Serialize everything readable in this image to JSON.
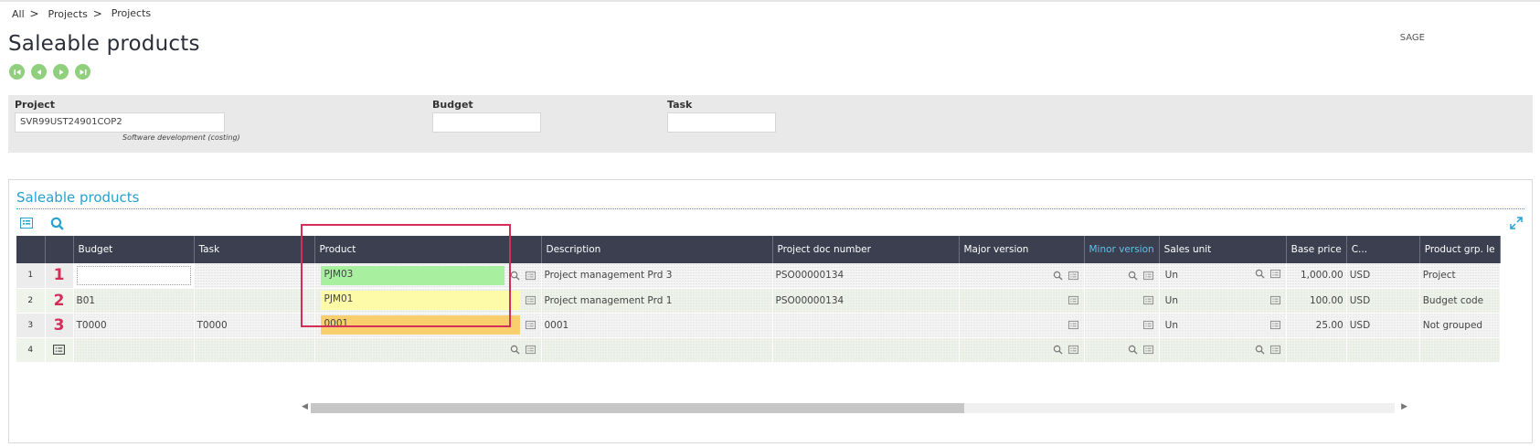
{
  "breadcrumb": [
    "All",
    "Projects",
    "Projects"
  ],
  "page_title": "Saleable products",
  "folder": "SAGE",
  "criteria": {
    "project_label": "Project",
    "project_value": "SVR99UST24901COP2",
    "project_help": "Software development (costing)",
    "budget_label": "Budget",
    "budget_value": "",
    "task_label": "Task",
    "task_value": ""
  },
  "section_title": "Saleable products",
  "columns": [
    "Budget",
    "Task",
    "Product",
    "Description",
    "Project doc number",
    "Major version",
    "Minor version",
    "Sales unit",
    "Base price",
    "C...",
    "Product grp. le"
  ],
  "rows": [
    {
      "num": "1",
      "marker": "1",
      "budget": "",
      "task": "",
      "product": "PJM03",
      "description": "Project management Prd 3",
      "doc": "PSO00000134",
      "major": "",
      "minor": "",
      "unit": "Un",
      "price": "1,000.00",
      "cur": "USD",
      "grp": "Project"
    },
    {
      "num": "2",
      "marker": "2",
      "budget": "B01",
      "task": "",
      "product": "PJM01",
      "description": "Project management Prd 1",
      "doc": "PSO00000134",
      "major": "",
      "minor": "",
      "unit": "Un",
      "price": "100.00",
      "cur": "USD",
      "grp": "Budget code"
    },
    {
      "num": "3",
      "marker": "3",
      "budget": "T0000",
      "task": "T0000",
      "product": "0001",
      "description": "0001",
      "doc": "",
      "major": "",
      "minor": "",
      "unit": "Un",
      "price": "25.00",
      "cur": "USD",
      "grp": "Not grouped"
    },
    {
      "num": "4",
      "marker": "",
      "budget": "",
      "task": "",
      "product": "",
      "description": "",
      "doc": "",
      "major": "",
      "minor": "",
      "unit": "",
      "price": "",
      "cur": "",
      "grp": ""
    }
  ],
  "colors": {
    "accent": "#27a1d0",
    "header": "#3b3f4f",
    "nav": "#8fcf7d",
    "highlight": "#d42d5a"
  }
}
